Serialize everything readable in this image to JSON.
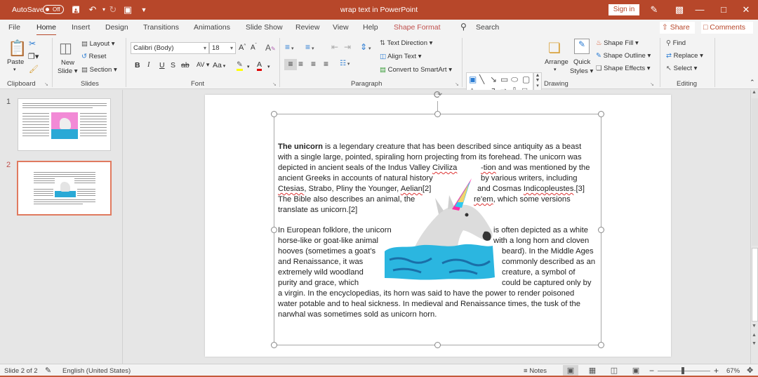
{
  "titlebar": {
    "autosave_label": "AutoSave",
    "autosave_state": "Off",
    "doc_title": "wrap text in PowerPoint",
    "sign_in": "Sign in",
    "icons": [
      "save-icon",
      "undo-icon",
      "redo-icon",
      "present-icon",
      "customize-qat-icon",
      "pen-icon",
      "ribbon-display-icon",
      "minimize-icon",
      "maximize-icon",
      "close-icon"
    ]
  },
  "tabs": [
    {
      "label": "File"
    },
    {
      "label": "Home",
      "active": true
    },
    {
      "label": "Insert"
    },
    {
      "label": "Design"
    },
    {
      "label": "Transitions"
    },
    {
      "label": "Animations"
    },
    {
      "label": "Slide Show"
    },
    {
      "label": "Review"
    },
    {
      "label": "View"
    },
    {
      "label": "Help"
    },
    {
      "label": "Shape Format",
      "contextual": true
    }
  ],
  "search": {
    "label": "Search"
  },
  "share": {
    "label": "Share"
  },
  "comments": {
    "label": "Comments"
  },
  "ribbon": {
    "clipboard": {
      "label": "Clipboard",
      "paste": "Paste"
    },
    "slides": {
      "label": "Slides",
      "new_slide_1": "New",
      "new_slide_2": "Slide",
      "layout": "Layout",
      "reset": "Reset",
      "section": "Section"
    },
    "font": {
      "label": "Font",
      "font_name": "Calibri (Body)",
      "font_size": "18",
      "bold": "B",
      "italic": "I",
      "underline": "U",
      "shadow": "S",
      "strike": "ab",
      "spacing": "AV",
      "case": "Aa",
      "grow": "A",
      "shrink": "A",
      "highlight_color": "#ffff00",
      "font_color": "#e00000"
    },
    "paragraph": {
      "label": "Paragraph",
      "text_direction": "Text Direction",
      "align_text": "Align Text",
      "convert_smartart": "Convert to SmartArt"
    },
    "drawing": {
      "label": "Drawing",
      "arrange": "Arrange",
      "quick_styles_1": "Quick",
      "quick_styles_2": "Styles",
      "shape_fill": "Shape Fill",
      "shape_outline": "Shape Outline",
      "shape_effects": "Shape Effects"
    },
    "editing": {
      "label": "Editing",
      "find": "Find",
      "replace": "Replace",
      "select": "Select"
    }
  },
  "slides_panel": [
    {
      "number": "1"
    },
    {
      "number": "2",
      "active": true
    }
  ],
  "slide_text": {
    "p1": [
      {
        "segments": [
          {
            "t": "The unicorn",
            "b": true
          },
          {
            "t": " is a legendary creature that has been described since antiquity as a beast"
          }
        ]
      },
      {
        "segments": [
          {
            "t": "with a single large, pointed, spiraling horn projecting from its forehead. The unicorn was"
          }
        ]
      },
      {
        "segments": [
          {
            "t": "depicted in ancient seals of the Indus Valley "
          },
          {
            "t": "Civiliza",
            "s": true
          }
        ],
        "right": [
          {
            "t": "-tion",
            "s": true
          },
          {
            "t": " and was mentioned by the"
          }
        ]
      },
      {
        "segments": [
          {
            "t": "ancient Greeks in accounts of natural history"
          }
        ],
        "right": [
          {
            "t": "by various writers, including"
          }
        ]
      },
      {
        "segments": [
          {
            "t": "Ctesias",
            "s": true
          },
          {
            "t": ", Strabo, Pliny the Younger, "
          },
          {
            "t": "Aelian",
            "s": true
          },
          {
            "t": "[2]"
          }
        ],
        "right": [
          {
            "t": "and Cosmas "
          },
          {
            "t": "Indicopleustes",
            "s": true
          },
          {
            "t": ".[3]"
          }
        ]
      },
      {
        "segments": [
          {
            "t": "The Bible also describes an animal, the"
          }
        ],
        "right": [
          {
            "t": "re'em",
            "s": true
          },
          {
            "t": ", which some versions"
          }
        ]
      },
      {
        "segments": [
          {
            "t": "translate as unicorn.[2]"
          }
        ]
      }
    ],
    "p2": [
      {
        "segments": [
          {
            "t": "In European folklore, the unicorn"
          }
        ],
        "right": [
          {
            "t": "is often depicted as a white"
          }
        ]
      },
      {
        "segments": [
          {
            "t": "horse-like or goat-like animal"
          }
        ],
        "right": [
          {
            "t": "with a long horn and cloven"
          }
        ]
      },
      {
        "segments": [
          {
            "t": "hooves (sometimes a goat’s"
          }
        ],
        "right": [
          {
            "t": "beard). In the Middle Ages"
          }
        ]
      },
      {
        "segments": [
          {
            "t": "and Renaissance, it was"
          }
        ],
        "right": [
          {
            "t": "commonly described as an"
          }
        ]
      },
      {
        "segments": [
          {
            "t": "extremely wild woodland"
          }
        ],
        "right": [
          {
            "t": "creature, a symbol of"
          }
        ]
      },
      {
        "segments": [
          {
            "t": "purity and grace, which"
          }
        ],
        "right": [
          {
            "t": "could be captured only by"
          }
        ]
      },
      {
        "segments": [
          {
            "t": "a virgin. In the encyclopedias, its horn was said to have the power to render poisoned"
          }
        ]
      },
      {
        "segments": [
          {
            "t": "water potable and to heal sickness. In medieval and Renaissance times, the tusk of the"
          }
        ]
      },
      {
        "segments": [
          {
            "t": "narwhal was sometimes sold as unicorn horn."
          }
        ]
      }
    ]
  },
  "image": {
    "subject": "unicorn-on-blue-moss",
    "horn_colors": [
      "#ff2fa6",
      "#2ec8f0",
      "#f2d36b"
    ],
    "moss_color": "#2bb6e0"
  },
  "statusbar": {
    "slide_info": "Slide 2 of 2",
    "language": "English (United States)",
    "notes": "Notes",
    "zoom_level": "67%",
    "zoom_fraction": 0.45
  },
  "colors": {
    "accent": "#b7472a",
    "contextual_tab": "#c0504d",
    "selected_thumb": "#e07a5f"
  }
}
